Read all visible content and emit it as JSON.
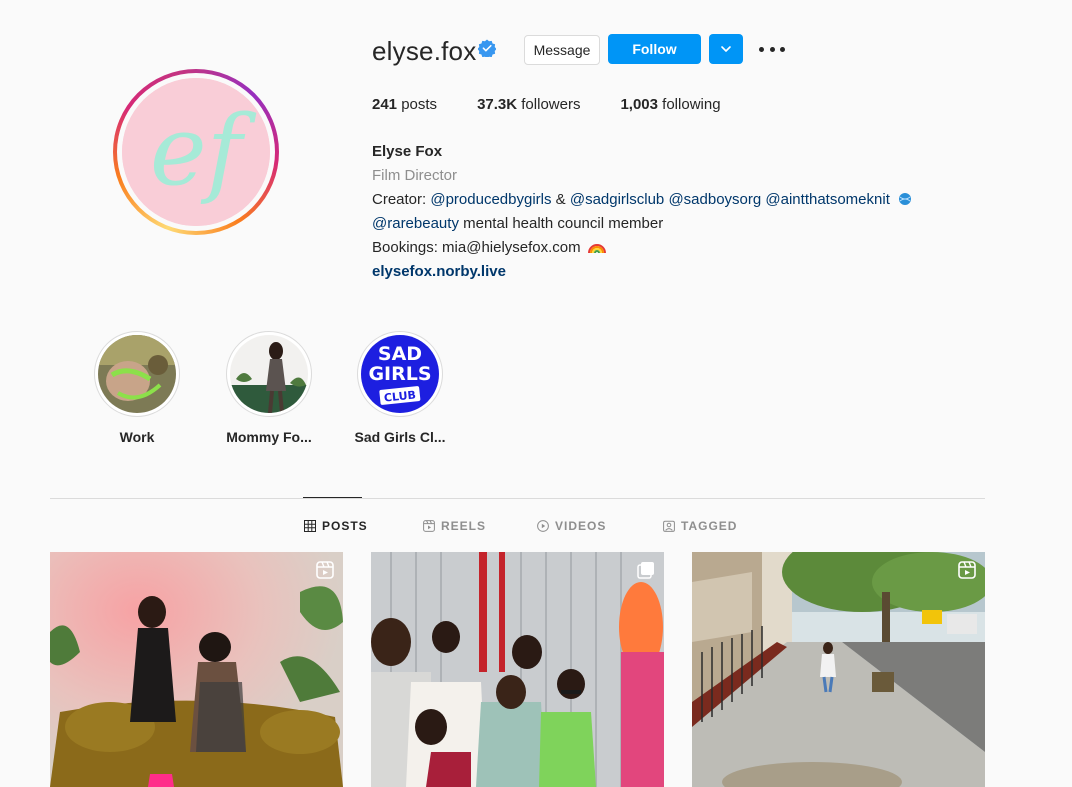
{
  "profile": {
    "username": "elyse.fox",
    "avatar_initials": "ef",
    "verified": true,
    "buttons": {
      "message": "Message",
      "follow": "Follow"
    },
    "stats": {
      "posts_count": "241",
      "posts_label": "posts",
      "followers_count": "37.3K",
      "followers_label": "followers",
      "following_count": "1,003",
      "following_label": "following"
    },
    "bio": {
      "full_name": "Elyse Fox",
      "category": "Film Director",
      "line1_prefix": "Creator:",
      "line1_tags": [
        "@producedbygirls",
        "&",
        "@sadgirlsclub",
        "@sadboysorg",
        "@aintthatsomeknit"
      ],
      "line2_tag": "@rarebeauty",
      "line2_text": "mental health council member",
      "line3_text": "Bookings: mia@hielysefox.com",
      "link": "elysefox.norby.live"
    }
  },
  "highlights": [
    {
      "label": "Work"
    },
    {
      "label": "Mommy Fo..."
    },
    {
      "label": "Sad Girls Cl...",
      "art_text": [
        "SAD",
        "GIRLS",
        "CLUB"
      ]
    }
  ],
  "tabs": [
    {
      "label": "POSTS",
      "icon": "grid-icon",
      "active": true
    },
    {
      "label": "REELS",
      "icon": "reels-icon",
      "active": false
    },
    {
      "label": "VIDEOS",
      "icon": "play-icon",
      "active": false
    },
    {
      "label": "TAGGED",
      "icon": "tagged-icon",
      "active": false
    }
  ],
  "posts": [
    {
      "type": "reel",
      "icon": "reel-badge-icon"
    },
    {
      "type": "carousel",
      "icon": "carousel-badge-icon"
    },
    {
      "type": "reel",
      "icon": "reel-badge-icon"
    }
  ],
  "colors": {
    "follow_blue": "#0095f6",
    "link_blue": "#00376b",
    "avatar_pink": "#f9cdd7",
    "avatar_mint": "#a6ead7",
    "sgc_blue": "#1d1fe0"
  }
}
